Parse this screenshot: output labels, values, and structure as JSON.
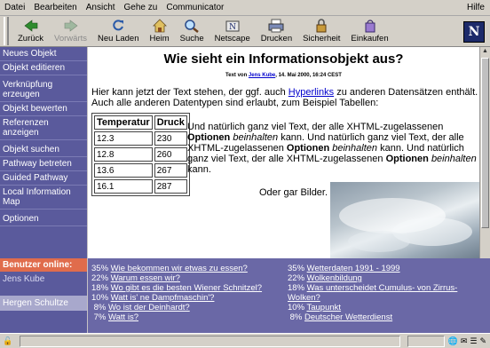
{
  "menu": [
    "Datei",
    "Bearbeiten",
    "Ansicht",
    "Gehe zu",
    "Communicator"
  ],
  "menu_help": "Hilfe",
  "toolbar": {
    "back": "Zurück",
    "forward": "Vorwärts",
    "reload": "Neu Laden",
    "home": "Heim",
    "search": "Suche",
    "netscape": "Netscape",
    "print": "Drucken",
    "security": "Sicherheit",
    "shop": "Einkaufen",
    "logo": "N"
  },
  "sidebar": {
    "items": [
      "Neues Objekt",
      "Objekt editieren",
      "Verknüpfung erzeugen",
      "Objekt bewerten",
      "Referenzen anzeigen",
      "Objekt suchen",
      "Pathway betreten",
      "Guided Pathway",
      "Local Information Map",
      "Optionen"
    ]
  },
  "online": {
    "title": "Benutzer online:",
    "users": [
      "Jens Kube",
      "Hergen Schultze"
    ]
  },
  "content": {
    "title": "Wie sieht ein Informationsobjekt aus?",
    "byline_pre": "Text von",
    "byline_author": "Jens Kube",
    "byline_post": ", 14. Mai 2000, 16:24 CEST",
    "intro_pre": "Hier kann jetzt der Text stehen, der ggf. auch",
    "intro_link": "Hyperlinks",
    "intro_post": "zu anderen Datensätzen enthält. Auch alle anderen Datentypen sind erlaubt, zum Beispiel Tabellen:",
    "table": {
      "headers": [
        "Temperatur",
        "Druck"
      ],
      "rows": [
        [
          "12.3",
          "230"
        ],
        [
          "12.8",
          "260"
        ],
        [
          "13.6",
          "267"
        ],
        [
          "16.1",
          "287"
        ]
      ]
    },
    "sidetext": {
      "t1": "Und natürlich ganz viel Text, der alle XHTML-zugelassenen",
      "b1": "Optionen",
      "i1": "beinhalten",
      "t2": "kann. Und natürlich ganz viel Text, der alle XHTML-zugelassenen",
      "b2": "Optionen",
      "i2": "beinhalten",
      "t3": "kann. Und natürlich ganz viel Text, der alle XHTML-zugelassenen",
      "b3": "Optionen",
      "i3": "beinhalten",
      "t4": "kann."
    },
    "images_text": "Oder gar Bilder."
  },
  "links": {
    "left": [
      {
        "pct": "35%",
        "text": "Wie bekommen wir etwas zu essen?"
      },
      {
        "pct": "22%",
        "text": "Warum essen wir?"
      },
      {
        "pct": "18%",
        "text": "Wo gibt es die besten Wiener Schnitzel?"
      },
      {
        "pct": "10%",
        "text": "Watt is' ne Dampfmaschin'?"
      },
      {
        "pct": "8%",
        "text": "Wo ist der Deinhardt?"
      },
      {
        "pct": "7%",
        "text": "Watt is?"
      }
    ],
    "right": [
      {
        "pct": "35%",
        "text": "Wetterdaten 1991 - 1999"
      },
      {
        "pct": "22%",
        "text": "Wolkenbildung"
      },
      {
        "pct": "18%",
        "text": "Was unterscheidet Cumulus- von Zirrus-Wolken?"
      },
      {
        "pct": "10%",
        "text": "Taupunkt"
      },
      {
        "pct": "8%",
        "text": "Deutscher Wetterdienst"
      }
    ]
  },
  "colors": {
    "sidebar": "#5a5a9c",
    "links_bg": "#6a68a6",
    "online_title": "#e06c4c",
    "link_blue": "#0000cc"
  }
}
